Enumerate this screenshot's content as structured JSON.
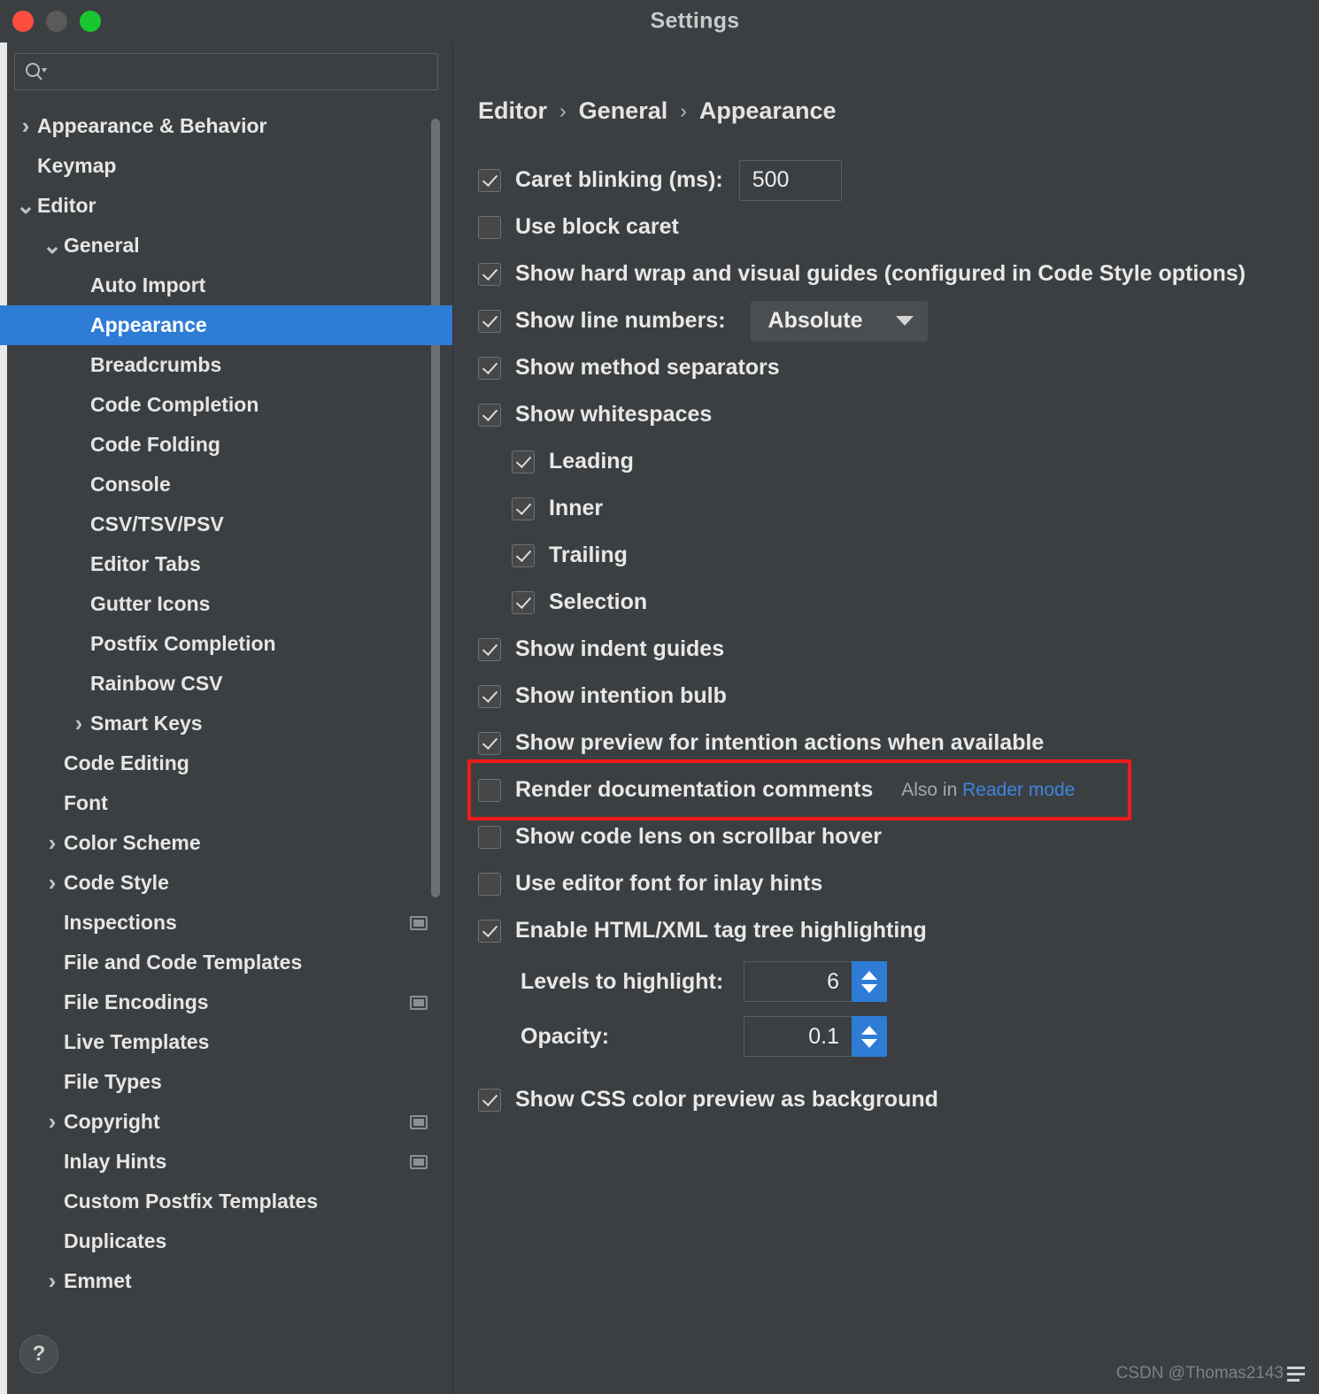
{
  "window": {
    "title": "Settings",
    "traffic_lights": [
      "close-button",
      "minimize-button",
      "maximize-button"
    ]
  },
  "search": {
    "placeholder": "",
    "value": "",
    "icon": "search-icon"
  },
  "sidebar": {
    "items": [
      {
        "label": "Appearance & Behavior",
        "level": 0,
        "arrow": "right",
        "selected": false,
        "scope_icon": false
      },
      {
        "label": "Keymap",
        "level": 0,
        "arrow": "none",
        "selected": false,
        "scope_icon": false
      },
      {
        "label": "Editor",
        "level": 0,
        "arrow": "down",
        "selected": false,
        "scope_icon": false
      },
      {
        "label": "General",
        "level": 1,
        "arrow": "down",
        "selected": false,
        "scope_icon": false
      },
      {
        "label": "Auto Import",
        "level": 2,
        "arrow": "none",
        "selected": false,
        "scope_icon": false
      },
      {
        "label": "Appearance",
        "level": 2,
        "arrow": "none",
        "selected": true,
        "scope_icon": false
      },
      {
        "label": "Breadcrumbs",
        "level": 2,
        "arrow": "none",
        "selected": false,
        "scope_icon": false
      },
      {
        "label": "Code Completion",
        "level": 2,
        "arrow": "none",
        "selected": false,
        "scope_icon": false
      },
      {
        "label": "Code Folding",
        "level": 2,
        "arrow": "none",
        "selected": false,
        "scope_icon": false
      },
      {
        "label": "Console",
        "level": 2,
        "arrow": "none",
        "selected": false,
        "scope_icon": false
      },
      {
        "label": "CSV/TSV/PSV",
        "level": 2,
        "arrow": "none",
        "selected": false,
        "scope_icon": false
      },
      {
        "label": "Editor Tabs",
        "level": 2,
        "arrow": "none",
        "selected": false,
        "scope_icon": false
      },
      {
        "label": "Gutter Icons",
        "level": 2,
        "arrow": "none",
        "selected": false,
        "scope_icon": false
      },
      {
        "label": "Postfix Completion",
        "level": 2,
        "arrow": "none",
        "selected": false,
        "scope_icon": false
      },
      {
        "label": "Rainbow CSV",
        "level": 2,
        "arrow": "none",
        "selected": false,
        "scope_icon": false
      },
      {
        "label": "Smart Keys",
        "level": 2,
        "arrow": "right",
        "selected": false,
        "scope_icon": false
      },
      {
        "label": "Code Editing",
        "level": 1,
        "arrow": "none",
        "selected": false,
        "scope_icon": false
      },
      {
        "label": "Font",
        "level": 1,
        "arrow": "none",
        "selected": false,
        "scope_icon": false
      },
      {
        "label": "Color Scheme",
        "level": 1,
        "arrow": "right",
        "selected": false,
        "scope_icon": false
      },
      {
        "label": "Code Style",
        "level": 1,
        "arrow": "right",
        "selected": false,
        "scope_icon": false
      },
      {
        "label": "Inspections",
        "level": 1,
        "arrow": "none",
        "selected": false,
        "scope_icon": true
      },
      {
        "label": "File and Code Templates",
        "level": 1,
        "arrow": "none",
        "selected": false,
        "scope_icon": false
      },
      {
        "label": "File Encodings",
        "level": 1,
        "arrow": "none",
        "selected": false,
        "scope_icon": true
      },
      {
        "label": "Live Templates",
        "level": 1,
        "arrow": "none",
        "selected": false,
        "scope_icon": false
      },
      {
        "label": "File Types",
        "level": 1,
        "arrow": "none",
        "selected": false,
        "scope_icon": false
      },
      {
        "label": "Copyright",
        "level": 1,
        "arrow": "right",
        "selected": false,
        "scope_icon": true
      },
      {
        "label": "Inlay Hints",
        "level": 1,
        "arrow": "none",
        "selected": false,
        "scope_icon": true
      },
      {
        "label": "Custom Postfix Templates",
        "level": 1,
        "arrow": "none",
        "selected": false,
        "scope_icon": false
      },
      {
        "label": "Duplicates",
        "level": 1,
        "arrow": "none",
        "selected": false,
        "scope_icon": false
      },
      {
        "label": "Emmet",
        "level": 1,
        "arrow": "right",
        "selected": false,
        "scope_icon": false
      }
    ],
    "help_label": "?"
  },
  "main": {
    "breadcrumb": [
      "Editor",
      "General",
      "Appearance"
    ],
    "breadcrumb_separator": "›",
    "caret_blinking": {
      "label": "Caret blinking (ms):",
      "checked": true,
      "value": "500"
    },
    "use_block_caret": {
      "label": "Use block caret",
      "checked": false
    },
    "show_hard_wrap": {
      "label": "Show hard wrap and visual guides (configured in Code Style options)",
      "checked": true
    },
    "show_line_numbers": {
      "label": "Show line numbers:",
      "checked": true,
      "selected_option": "Absolute"
    },
    "show_method_separators": {
      "label": "Show method separators",
      "checked": true
    },
    "show_whitespaces": {
      "label": "Show whitespaces",
      "checked": true
    },
    "whitespace_children": [
      {
        "label": "Leading",
        "checked": true
      },
      {
        "label": "Inner",
        "checked": true
      },
      {
        "label": "Trailing",
        "checked": true
      },
      {
        "label": "Selection",
        "checked": true
      }
    ],
    "show_indent_guides": {
      "label": "Show indent guides",
      "checked": true
    },
    "show_intention_bulb": {
      "label": "Show intention bulb",
      "checked": true
    },
    "show_preview_intention": {
      "label": "Show preview for intention actions when available",
      "checked": true
    },
    "render_doc_comments": {
      "label": "Render documentation comments",
      "checked": false,
      "hint_prefix": "Also in",
      "hint_link": "Reader mode",
      "highlight_color": "#f21a1a"
    },
    "show_code_lens": {
      "label": "Show code lens on scrollbar hover",
      "checked": false
    },
    "use_editor_font_inlay": {
      "label": "Use editor font for inlay hints",
      "checked": false
    },
    "enable_tag_tree": {
      "label": "Enable HTML/XML tag tree highlighting",
      "checked": true
    },
    "levels_to_highlight": {
      "label": "Levels to highlight:",
      "value": "6"
    },
    "opacity": {
      "label": "Opacity:",
      "value": "0.1"
    },
    "show_css_color_preview": {
      "label": "Show CSS color preview as background",
      "checked": true
    }
  },
  "watermark": {
    "text": "CSDN @Thomas2143"
  },
  "colors": {
    "accent": "#2f7cd6",
    "background": "#3c3f41",
    "highlight_border": "#f21a1a",
    "link": "#3d86e0"
  }
}
